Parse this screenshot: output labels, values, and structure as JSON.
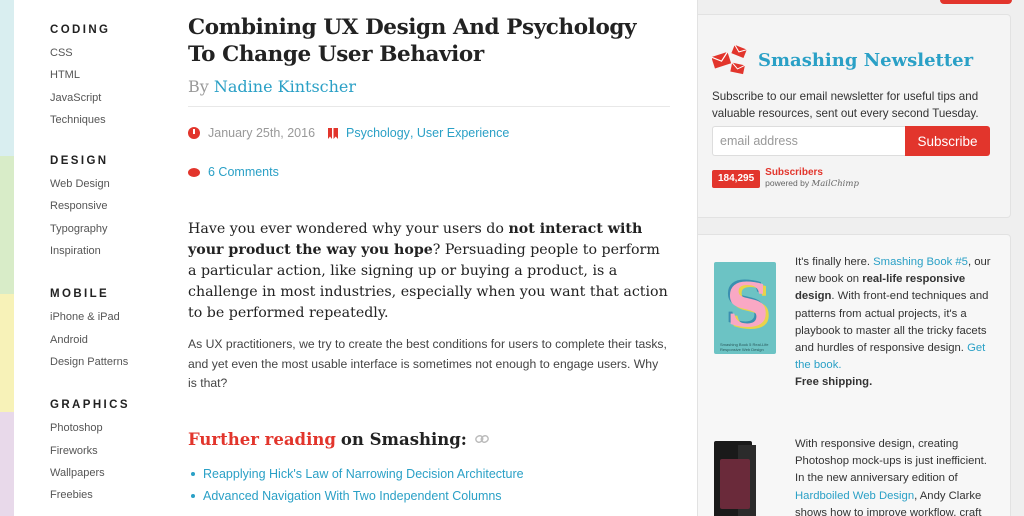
{
  "nav": {
    "sections": [
      {
        "heading": "CODING",
        "items": [
          "CSS",
          "HTML",
          "JavaScript",
          "Techniques"
        ]
      },
      {
        "heading": "DESIGN",
        "items": [
          "Web Design",
          "Responsive",
          "Typography",
          "Inspiration"
        ]
      },
      {
        "heading": "MOBILE",
        "items": [
          "iPhone & iPad",
          "Android",
          "Design Patterns"
        ]
      },
      {
        "heading": "GRAPHICS",
        "items": [
          "Photoshop",
          "Fireworks",
          "Wallpapers",
          "Freebies"
        ]
      }
    ]
  },
  "article": {
    "title": "Combining UX Design And Psychology To Change User Behavior",
    "by": "By",
    "author": "Nadine Kintscher",
    "date": "January 25th, 2016",
    "category1": "Psychology",
    "category_sep": ", ",
    "category2": "User Experience",
    "comments": "6 Comments",
    "lead_part1": "Have you ever wondered why your users do ",
    "lead_bold": "not interact with your product the way you hope",
    "lead_part2": "? Persuading people to perform a particular action, like signing up or buying a product, is a challenge in most industries, especially when you want that action to be performed repeatedly.",
    "paragraph": "As UX practitioners, we try to create the best conditions for users to complete their tasks, and yet even the most usable interface is sometimes not enough to engage users. Why is that?",
    "further_red": "Further reading",
    "further_rest": "on Smashing:",
    "reading_links": [
      "Reapplying Hick's Law of Narrowing Decision Architecture",
      "Advanced Navigation With Two Independent Columns"
    ]
  },
  "newsletter": {
    "title": "Smashing Newsletter",
    "description": "Subscribe to our email newsletter for useful tips and valuable resources, sent out every second Tuesday.",
    "placeholder": "email address",
    "button": "Subscribe",
    "count": "184,295",
    "subscribers_label": "Subscribers",
    "powered_by": "powered by",
    "powered_brand": "MailChimp"
  },
  "books": {
    "b1_pre": "It's finally here. ",
    "b1_link": "Smashing Book #5",
    "b1_mid1": ", our new book on ",
    "b1_bold": "real-life responsive design",
    "b1_mid2": ". With front-end techniques and patterns from actual projects, it's a playbook to master all the tricky facets and hurdles of responsive design. ",
    "b1_link2": "Get the book.",
    "b1_free": "Free shipping.",
    "b1_cover_letter": "S",
    "b1_cover_title": "Smashing Book 5 Real-Life Responsive Web Design",
    "b2_pre": "With responsive design, creating Photoshop mock-ups is just inefficient. In the new anniversary edition of ",
    "b2_link": "Hardboiled Web Design",
    "b2_post": ", Andy Clarke shows how to improve workflow, craft"
  },
  "colors": {
    "accent_blue": "#2aa0c6",
    "accent_red": "#e2352c"
  }
}
